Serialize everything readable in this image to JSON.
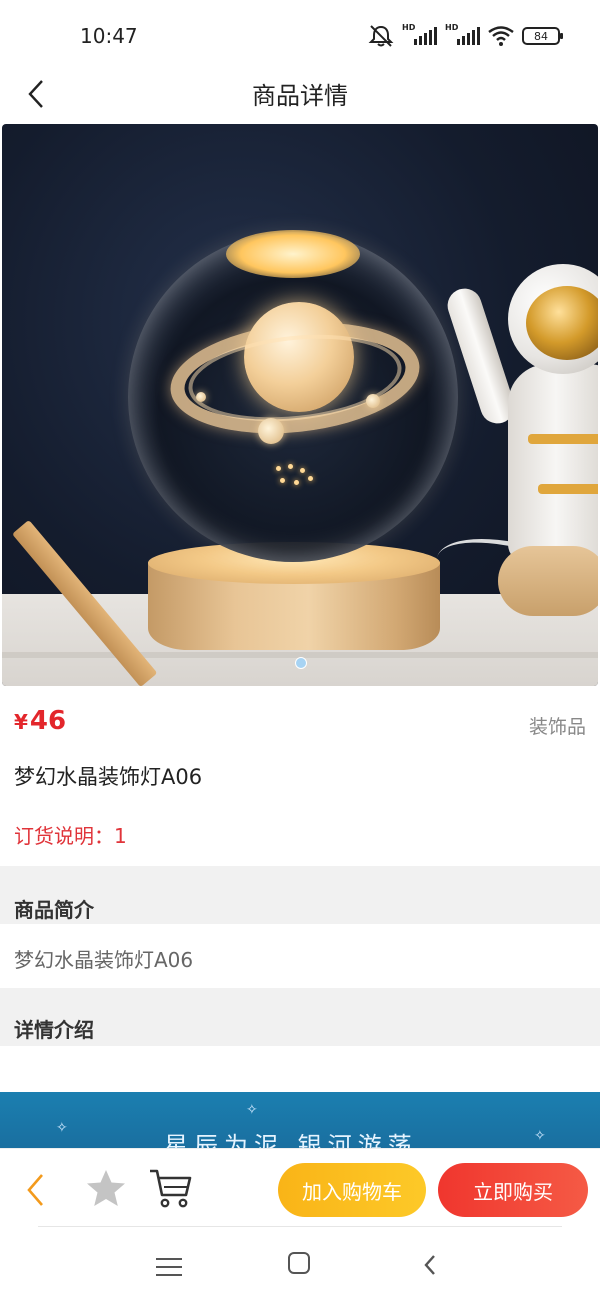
{
  "status_bar": {
    "time": "10:47",
    "battery": "84",
    "signal_label_1": "HD",
    "signal_label_2": "HD",
    "icons": [
      "mute-icon",
      "signal-icon",
      "signal-icon",
      "wifi-icon",
      "battery-icon"
    ]
  },
  "header": {
    "title": "商品详情",
    "back_icon": "chevron-left-icon"
  },
  "gallery": {
    "image_subject": "product-photo",
    "current_page": 1,
    "total_pages": 1
  },
  "product": {
    "currency": "¥",
    "price": "46",
    "category": "装饰品",
    "name": "梦幻水晶装饰灯A06",
    "order_note": "订货说明：1"
  },
  "sections": {
    "summary_title": "商品简介",
    "summary_text": "梦幻水晶装饰灯A06",
    "detail_title": "详情介绍",
    "detail_banner_text": "星辰为泥 银河游荡"
  },
  "bottom_bar": {
    "add_to_cart": "加入购物车",
    "buy_now": "立即购买",
    "icons": [
      "back-icon",
      "star-icon",
      "cart-icon"
    ]
  },
  "nav_bar": {
    "icons": [
      "menu-icon",
      "home-icon",
      "back-icon"
    ]
  },
  "colors": {
    "price_red": "#e3262b",
    "cart_button": "#fbbd1f",
    "buy_button": "#f2452f",
    "back_orange": "#f39a1c",
    "page_dot": "#a7d3f3"
  }
}
